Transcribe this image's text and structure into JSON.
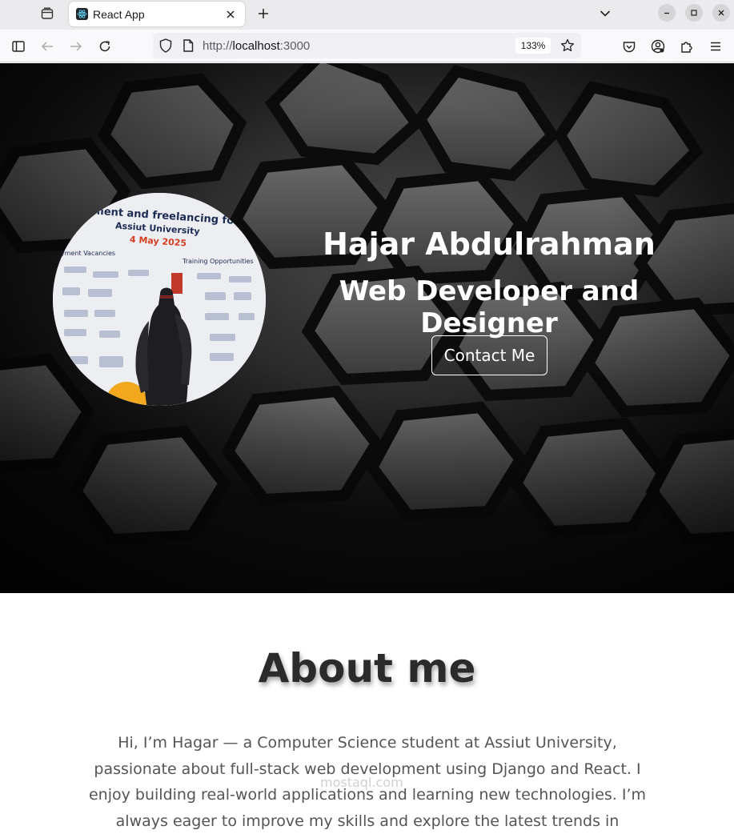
{
  "browser": {
    "tab_title": "React App",
    "url_prefix": "http://",
    "url_host": "localhost",
    "url_suffix": ":3000",
    "zoom": "133%"
  },
  "hero": {
    "name": "Hajar Abdulrahman",
    "role": "Web Developer and Designer",
    "contact_label": "Contact Me",
    "photo_banner": {
      "line1": "ment and freelancing forum",
      "line2": "Assiut University",
      "date": "4 May 2025",
      "left_label": "yment Vacancies",
      "right_label": "Training Opportunities"
    }
  },
  "about": {
    "title": "About me",
    "text": "Hi, I’m Hagar — a Computer Science student at Assiut University, passionate about full-stack web development using Django and React. I enjoy building real-world applications and learning new technologies. I’m always eager to improve my skills and explore the latest trends in"
  },
  "watermark": "mostaql.com"
}
